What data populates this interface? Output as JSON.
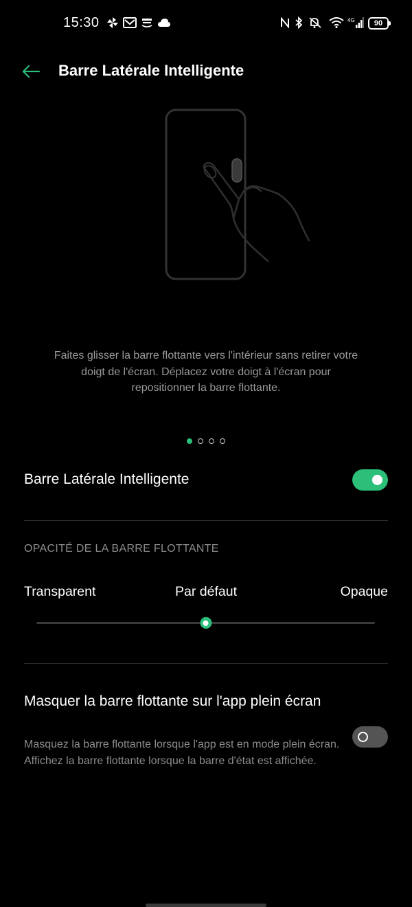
{
  "status_bar": {
    "time": "15:30",
    "battery": "90",
    "network": "4G",
    "left_icons": [
      "pinwheel-icon",
      "gmail-icon",
      "amazon-icon",
      "cloud-icon"
    ],
    "right_icons": [
      "nfc-icon",
      "bluetooth-icon",
      "mute-icon",
      "wifi-icon",
      "signal-icon"
    ]
  },
  "header": {
    "title": "Barre Latérale Intelligente",
    "accent_color": "#2bbf7a"
  },
  "illustration": {
    "description": "Faites glisser la barre flottante vers l'intérieur sans retirer votre doigt de l'écran. Déplacez votre doigt à l'écran pour repositionner la barre flottante.",
    "page_count": 4,
    "active_page": 1
  },
  "main_toggle": {
    "label": "Barre Latérale Intelligente",
    "enabled": true
  },
  "opacity": {
    "section_title": "OPACITÉ DE LA BARRE FLOTTANTE",
    "left_label": "Transparent",
    "middle_label": "Par défaut",
    "right_label": "Opaque",
    "value": 0.5
  },
  "hide_fullscreen": {
    "title": "Masquer la barre flottante sur l'app plein écran",
    "description": "Masquez la barre flottante lorsque l'app est en mode plein écran. Affichez la barre flottante lorsque la barre d'état est affichée.",
    "enabled": false
  }
}
